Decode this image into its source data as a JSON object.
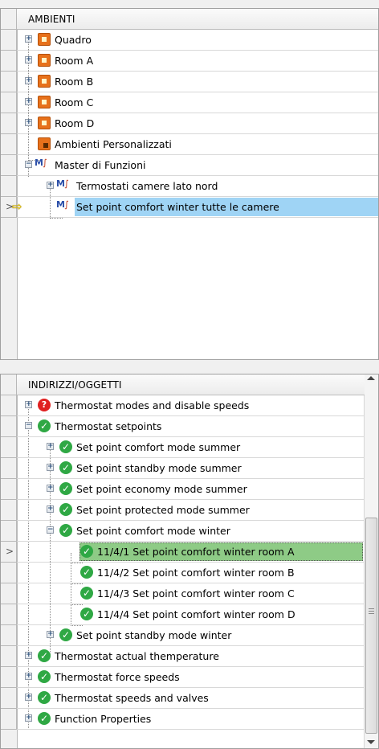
{
  "ambienti": {
    "header": "AMBIENTI",
    "rows": [
      {
        "label": "Quadro"
      },
      {
        "label": "Room A"
      },
      {
        "label": "Room B"
      },
      {
        "label": "Room C"
      },
      {
        "label": "Room D"
      },
      {
        "label": "Ambienti Personalizzati"
      },
      {
        "label": "Master di Funzioni"
      },
      {
        "label": "Termostati camere lato nord"
      },
      {
        "label": "Set point comfort winter tutte le camere"
      }
    ]
  },
  "indirizzi": {
    "header": "INDIRIZZI/OGGETTI",
    "rows": [
      {
        "label": "Thermostat modes and disable speeds"
      },
      {
        "label": "Thermostat setpoints"
      },
      {
        "label": "Set point comfort mode summer"
      },
      {
        "label": "Set point standby mode summer"
      },
      {
        "label": "Set point economy mode summer"
      },
      {
        "label": "Set point protected mode summer"
      },
      {
        "label": "Set point comfort mode winter"
      },
      {
        "label": "11/4/1 Set point comfort winter room A"
      },
      {
        "label": "11/4/2 Set point comfort winter room B"
      },
      {
        "label": "11/4/3 Set point comfort winter room C"
      },
      {
        "label": "11/4/4 Set point comfort winter room D"
      },
      {
        "label": "Set point standby mode winter"
      },
      {
        "label": "Thermostat actual themperature"
      },
      {
        "label": "Thermostat force speeds"
      },
      {
        "label": "Thermostat speeds and valves"
      },
      {
        "label": "Function Properties"
      }
    ]
  },
  "colors": {
    "selected_blue": "#9fd4f5",
    "selected_green": "#8ecb86",
    "status_ok": "#2fa844",
    "status_error": "#e02020",
    "room_icon": "#e7711b"
  },
  "icons": {
    "room": "room-box-icon",
    "custom": "custom-rooms-icon",
    "function_master": "function-master-icon",
    "ok": "check-circle-icon",
    "error": "question-circle-icon",
    "row_pointer": "yellow-arrow-icon"
  }
}
